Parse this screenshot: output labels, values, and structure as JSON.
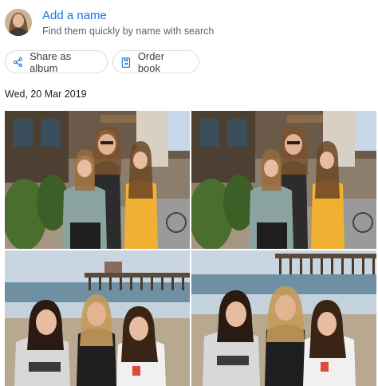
{
  "header": {
    "title": "Add a name",
    "subtitle": "Find them quickly by name with search"
  },
  "actions": {
    "share_label": "Share as album",
    "share_icon": "share-icon",
    "order_label": "Order book",
    "order_icon": "photo-book-icon"
  },
  "date_heading": "Wed, 20 Mar 2019",
  "photos": [
    {
      "scene": "street-storefront"
    },
    {
      "scene": "street-storefront"
    },
    {
      "scene": "beach-pier"
    },
    {
      "scene": "beach-pier"
    }
  ]
}
